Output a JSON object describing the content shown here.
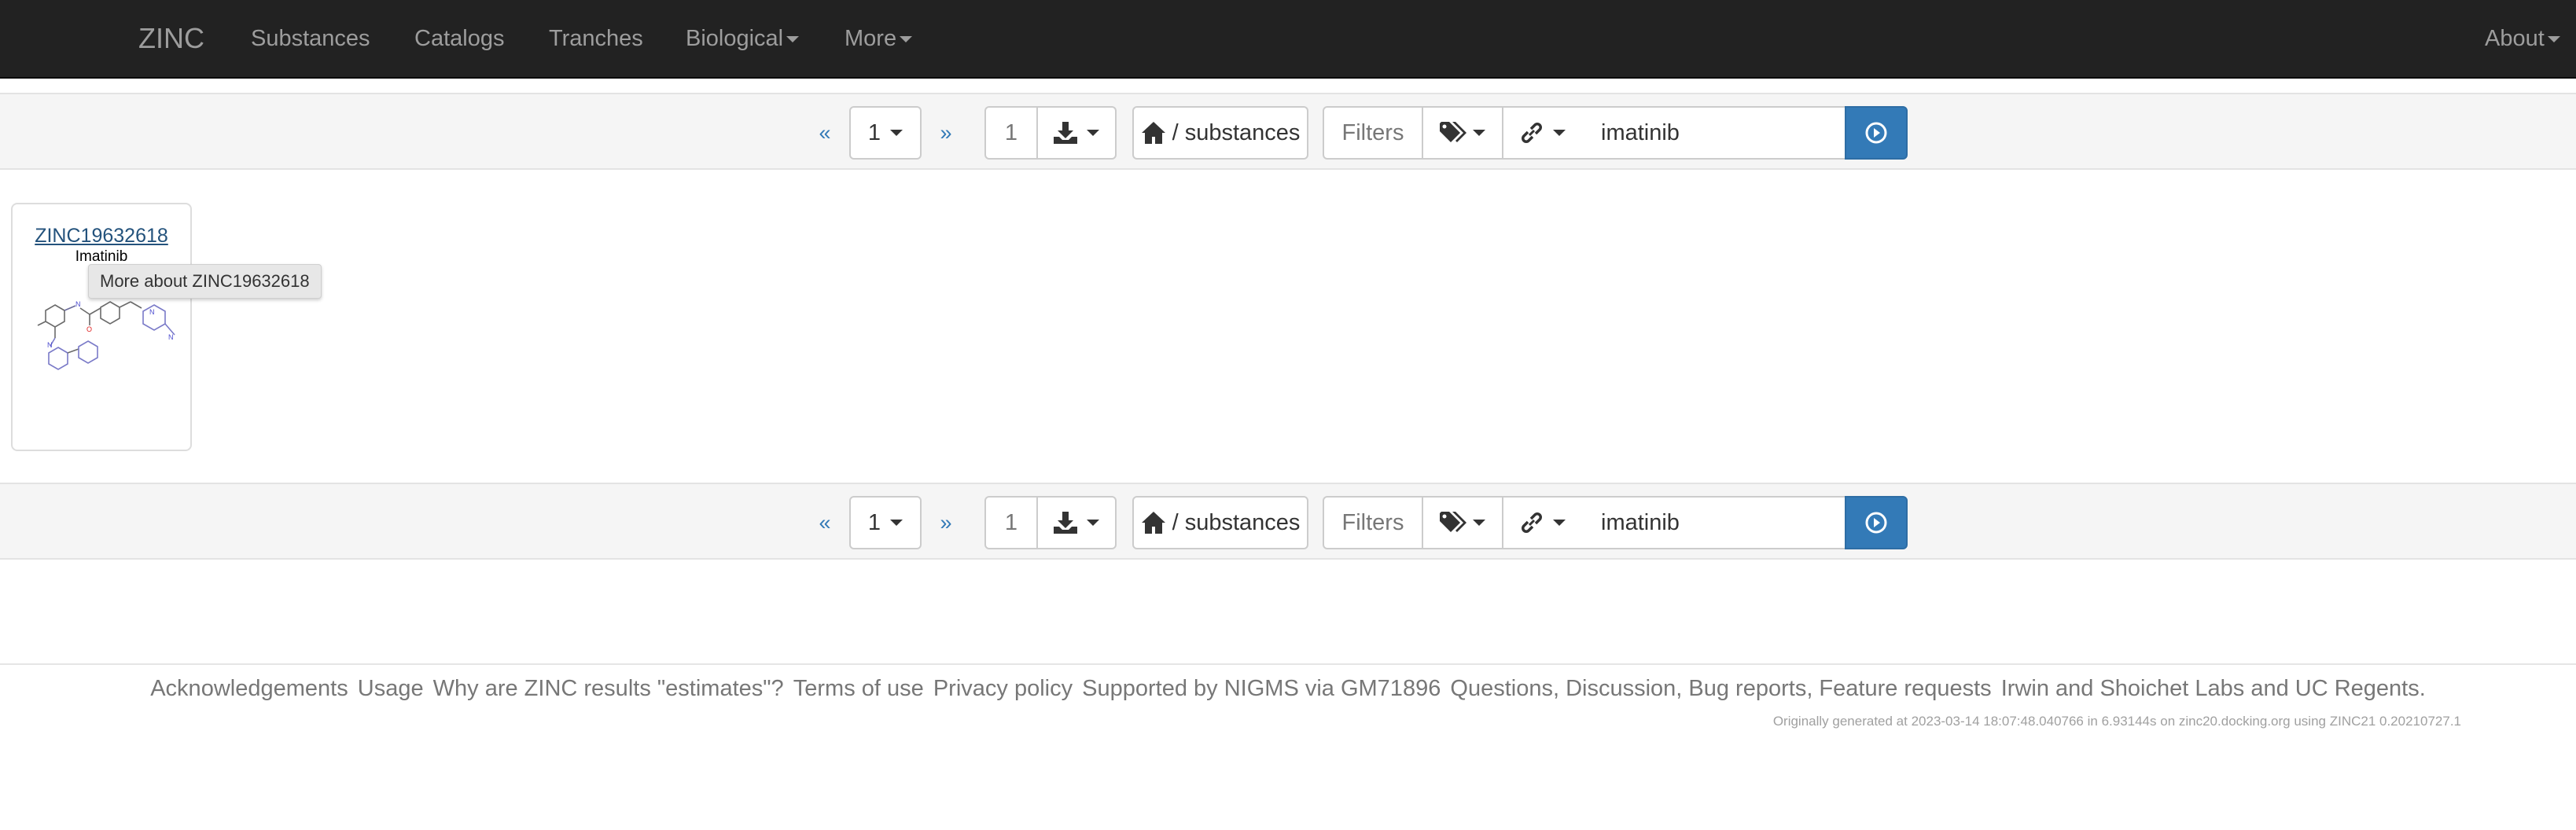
{
  "navbar": {
    "brand": "ZINC",
    "items": [
      {
        "label": "Substances",
        "dropdown": false
      },
      {
        "label": "Catalogs",
        "dropdown": false
      },
      {
        "label": "Tranches",
        "dropdown": false
      },
      {
        "label": "Biological",
        "dropdown": true
      },
      {
        "label": "More",
        "dropdown": true
      }
    ],
    "about": "About"
  },
  "toolbar": {
    "prev": "«",
    "page_select": "1",
    "next": "»",
    "count": "1",
    "download_icon": "download-icon",
    "home_icon": "home-icon",
    "path_label": "/ substances",
    "filters_label": "Filters",
    "tags_icon": "tags-icon",
    "link_icon": "link-icon",
    "search_value": "imatinib",
    "go_icon": "play-circle-icon",
    "accent": "#337ab7"
  },
  "results": [
    {
      "zinc_id": "ZINC19632618",
      "name": "Imatinib",
      "tooltip": "More about ZINC19632618"
    }
  ],
  "footer": {
    "links": [
      "Acknowledgements",
      "Usage",
      "Why are ZINC results \"estimates\"?",
      "Terms of use",
      "Privacy policy",
      "Supported by NIGMS via GM71896",
      "Questions, Discussion, Bug reports, Feature requests",
      "Irwin and Shoichet Labs and UC Regents."
    ],
    "generated": "Originally generated at 2023-03-14 18:07:48.040766 in 6.93144s on zinc20.docking.org using ZINC21 0.20210727.1"
  }
}
